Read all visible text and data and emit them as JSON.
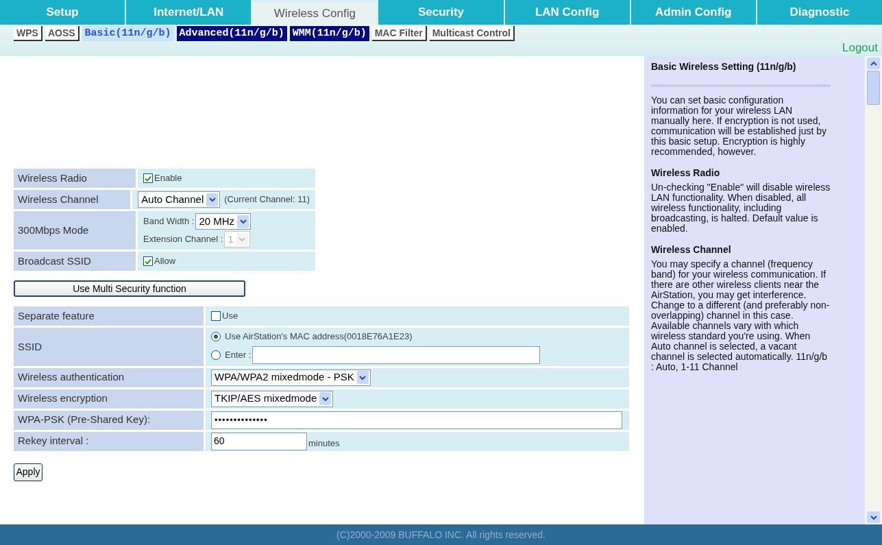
{
  "tabs": [
    {
      "label": "Setup",
      "selected": false
    },
    {
      "label": "Internet/LAN",
      "selected": false
    },
    {
      "label": "Wireless Config",
      "selected": true
    },
    {
      "label": "Security",
      "selected": false
    },
    {
      "label": "LAN Config",
      "selected": false
    },
    {
      "label": "Admin Config",
      "selected": false
    },
    {
      "label": "Diagnostic",
      "selected": false
    }
  ],
  "subtabs": [
    {
      "label": "WPS",
      "kind": "plain",
      "selected": false
    },
    {
      "label": "AOSS",
      "kind": "plain",
      "selected": false
    },
    {
      "label": "Basic(11n/g/b)",
      "kind": "band",
      "selected": true
    },
    {
      "label": "Advanced(11n/g/b)",
      "kind": "band",
      "selected": false
    },
    {
      "label": "WMM(11n/g/b)",
      "kind": "band",
      "selected": false
    },
    {
      "label": "MAC Filter",
      "kind": "plain",
      "selected": false
    },
    {
      "label": "Multicast Control",
      "kind": "plain",
      "selected": false
    }
  ],
  "logout": "Logout",
  "basic_rows": [
    {
      "label": "Wireless Radio",
      "kind": "checkbox",
      "text": "Enable",
      "checked": true
    },
    {
      "label": "Wireless Channel",
      "kind": "select",
      "value": "Auto Channel",
      "note": "(Current Channel: 11)"
    },
    {
      "label": "300Mbps Mode",
      "kind": "bandwidth",
      "band_label": "Band Width :",
      "band_value": "20 MHz",
      "ext_label": "Extension Channel :",
      "ext_value": "1",
      "ext_disabled": true
    },
    {
      "label": "Broadcast SSID",
      "kind": "checkbox",
      "text": "Allow",
      "checked": true
    }
  ],
  "multi_security_button": "Use Multi Security function",
  "security_rows": [
    {
      "label": "Separate feature",
      "kind": "checkbox",
      "text": "Use",
      "checked": false
    },
    {
      "label": "SSID",
      "kind": "radios",
      "options": [
        {
          "label": "Use AirStation's MAC address(0018E76A1E23)",
          "selected": true,
          "has_field": false
        },
        {
          "label": "Enter :",
          "selected": false,
          "has_field": true
        }
      ]
    },
    {
      "label": "Wireless authentication",
      "kind": "select",
      "value": "WPA/WPA2 mixedmode - PSK"
    },
    {
      "label": "Wireless encryption",
      "kind": "select",
      "value": "TKIP/AES mixedmode"
    },
    {
      "label": "WPA-PSK (Pre-Shared Key):",
      "kind": "password",
      "value": "••••••••••••••"
    },
    {
      "label": "Rekey interval :",
      "kind": "number",
      "value": "60",
      "unit": "minutes"
    }
  ],
  "apply_button": "Apply",
  "help": {
    "title": "Basic Wireless Setting (11n/g/b)",
    "intro": "You can set basic configuration information for your wireless LAN manually here. If encryption is not used, communication will be established just by this basic setup. Encryption is highly recommended, however.",
    "sections": [
      {
        "heading": "Wireless Radio",
        "text": "Un-checking \"Enable\" will disable wireless LAN functionality. When disabled, all wireless functionality, including broadcasting, is halted. Default value is enabled."
      },
      {
        "heading": "Wireless Channel",
        "text": "You may specify a channel (frequency band) for your wireless communication. If there are other wireless clients near the AirStation, you may get interference. Change to a different (and preferably non-overlapping) channel in this case. Available channels vary with which wireless standard you're using. When Auto channel is selected, a vacant channel is selected automatically. 11n/g/b : Auto, 1-11 Channel"
      }
    ]
  },
  "footer": "(C)2000-2009 BUFFALO INC. All rights reserved."
}
